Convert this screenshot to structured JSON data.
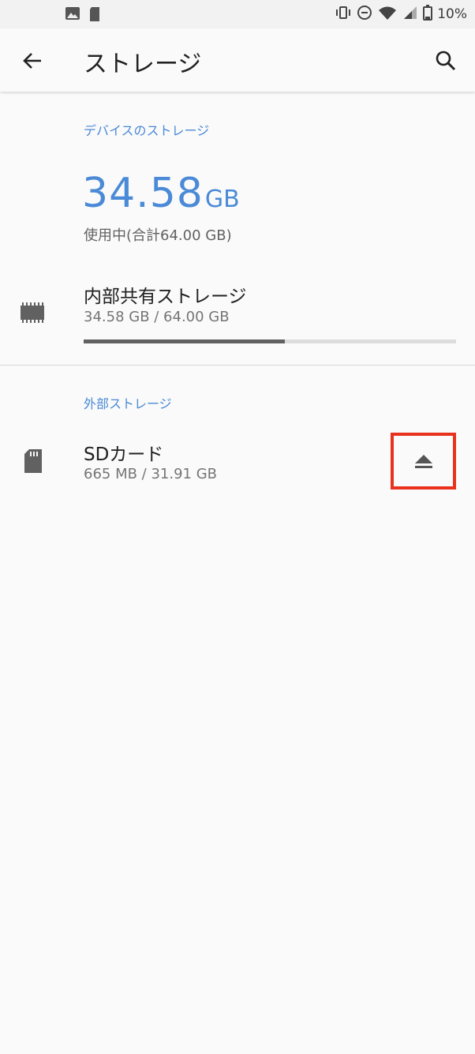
{
  "status_bar": {
    "left_icons": [
      "image-icon",
      "sd-card-icon"
    ],
    "right_icons": [
      "vibrate-icon",
      "do-not-disturb-icon",
      "wifi-icon",
      "cell-signal-icon",
      "battery-icon"
    ],
    "battery_percent": "10%"
  },
  "app_bar": {
    "title": "ストレージ",
    "back_icon": "arrow-back-icon",
    "search_icon": "search-icon"
  },
  "device_storage": {
    "header": "デバイスのストレージ",
    "used_value": "34.58",
    "used_unit": "GB",
    "used_caption": "使用中(合計64.00 GB)"
  },
  "internal_storage": {
    "title": "内部共有ストレージ",
    "summary": "34.58 GB / 64.00 GB",
    "used_fraction": 0.54,
    "icon": "memory-chip-icon"
  },
  "external_storage": {
    "header": "外部ストレージ",
    "sd_title": "SDカード",
    "sd_summary": "665 MB / 31.91 GB",
    "icon": "sd-card-icon",
    "action_icon": "eject-icon"
  },
  "colors": {
    "accent": "#4a8ad6",
    "highlight": "#e8321e",
    "progress_fill": "#616161",
    "progress_track": "#dcdcdc"
  }
}
